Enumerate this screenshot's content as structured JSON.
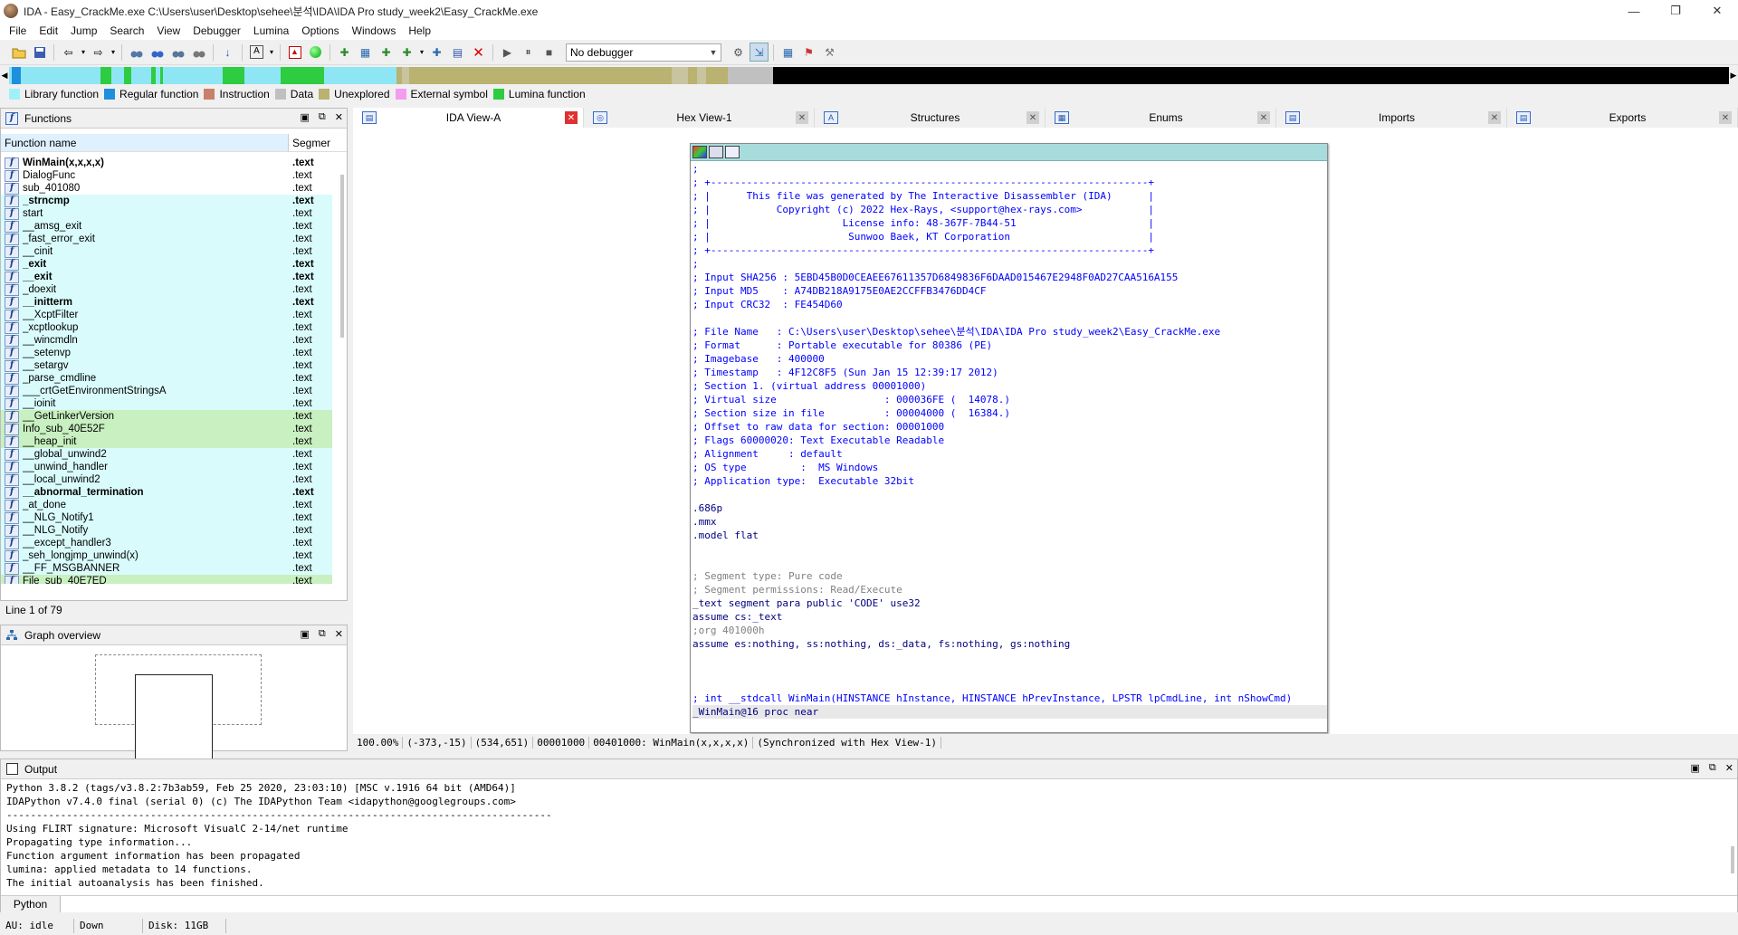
{
  "window": {
    "title": "IDA - Easy_CrackMe.exe C:\\Users\\user\\Desktop\\sehee\\분석\\IDA\\IDA Pro study_week2\\Easy_CrackMe.exe",
    "minimize": "—",
    "restore": "❐",
    "close": "✕"
  },
  "menu": [
    "File",
    "Edit",
    "Jump",
    "Search",
    "View",
    "Debugger",
    "Lumina",
    "Options",
    "Windows",
    "Help"
  ],
  "toolbar": {
    "debugger_select": "No debugger"
  },
  "navband": {
    "segments": [
      {
        "color": "#8ee6f4",
        "w": 3
      },
      {
        "color": "#1e8fdc",
        "w": 10
      },
      {
        "color": "#8ee6f4",
        "w": 88
      },
      {
        "color": "#2ecc40",
        "w": 12
      },
      {
        "color": "#8ee6f4",
        "w": 14
      },
      {
        "color": "#2ecc40",
        "w": 8
      },
      {
        "color": "#8ee6f4",
        "w": 22
      },
      {
        "color": "#2ecc40",
        "w": 5
      },
      {
        "color": "#8ee6f4",
        "w": 5
      },
      {
        "color": "#2ecc40",
        "w": 3
      },
      {
        "color": "#8ee6f4",
        "w": 66
      },
      {
        "color": "#2ecc40",
        "w": 24
      },
      {
        "color": "#8ee6f4",
        "w": 40
      },
      {
        "color": "#2ecc40",
        "w": 48
      },
      {
        "color": "#8ee6f4",
        "w": 80
      },
      {
        "color": "#b9b270",
        "w": 6
      },
      {
        "color": "#c8c4a0",
        "w": 8
      },
      {
        "color": "#b9b270",
        "w": 290
      },
      {
        "color": "#c8c4a0",
        "w": 18
      },
      {
        "color": "#b9b270",
        "w": 10
      },
      {
        "color": "#c8c4a0",
        "w": 10
      },
      {
        "color": "#b9b270",
        "w": 24
      },
      {
        "color": "#c0c0c0",
        "w": 50
      },
      {
        "color": "#000000",
        "w": 1056
      }
    ]
  },
  "legend": [
    {
      "label": "Library function",
      "color": "#a0f0f8"
    },
    {
      "label": "Regular function",
      "color": "#1e8fdc"
    },
    {
      "label": "Instruction",
      "color": "#c8806a"
    },
    {
      "label": "Data",
      "color": "#c0c0c0"
    },
    {
      "label": "Unexplored",
      "color": "#b9b270"
    },
    {
      "label": "External symbol",
      "color": "#f49cf0"
    },
    {
      "label": "Lumina function",
      "color": "#2ecc40"
    }
  ],
  "functions_panel": {
    "title": "Functions",
    "col_name": "Function name",
    "col_segment": "Segmer",
    "status": "Line 1 of 79",
    "rows": [
      {
        "name": "WinMain(x,x,x,x)",
        "seg": ".text",
        "bg": "plain",
        "bold": true
      },
      {
        "name": "DialogFunc",
        "seg": ".text",
        "bg": "plain",
        "bold": false
      },
      {
        "name": "sub_401080",
        "seg": ".text",
        "bg": "plain",
        "bold": false
      },
      {
        "name": "_strncmp",
        "seg": ".text",
        "bg": "lib",
        "bold": true
      },
      {
        "name": "start",
        "seg": ".text",
        "bg": "lib",
        "bold": false
      },
      {
        "name": "__amsg_exit",
        "seg": ".text",
        "bg": "lib",
        "bold": false
      },
      {
        "name": "_fast_error_exit",
        "seg": ".text",
        "bg": "lib",
        "bold": false
      },
      {
        "name": "__cinit",
        "seg": ".text",
        "bg": "lib",
        "bold": false
      },
      {
        "name": "_exit",
        "seg": ".text",
        "bg": "lib",
        "bold": true
      },
      {
        "name": "__exit",
        "seg": ".text",
        "bg": "lib",
        "bold": true
      },
      {
        "name": "_doexit",
        "seg": ".text",
        "bg": "lib",
        "bold": false
      },
      {
        "name": "__initterm",
        "seg": ".text",
        "bg": "lib",
        "bold": true
      },
      {
        "name": "__XcptFilter",
        "seg": ".text",
        "bg": "lib",
        "bold": false
      },
      {
        "name": "_xcptlookup",
        "seg": ".text",
        "bg": "lib",
        "bold": false
      },
      {
        "name": "__wincmdln",
        "seg": ".text",
        "bg": "lib",
        "bold": false
      },
      {
        "name": "__setenvp",
        "seg": ".text",
        "bg": "lib",
        "bold": false
      },
      {
        "name": "__setargv",
        "seg": ".text",
        "bg": "lib",
        "bold": false
      },
      {
        "name": "_parse_cmdline",
        "seg": ".text",
        "bg": "lib",
        "bold": false
      },
      {
        "name": "___crtGetEnvironmentStringsA",
        "seg": ".text",
        "bg": "lib",
        "bold": false
      },
      {
        "name": "__ioinit",
        "seg": ".text",
        "bg": "lib",
        "bold": false
      },
      {
        "name": "__GetLinkerVersion",
        "seg": ".text",
        "bg": "lum",
        "bold": false
      },
      {
        "name": "Info_sub_40E52F",
        "seg": ".text",
        "bg": "lum",
        "bold": false
      },
      {
        "name": "__heap_init",
        "seg": ".text",
        "bg": "lum",
        "bold": false
      },
      {
        "name": "__global_unwind2",
        "seg": ".text",
        "bg": "lib",
        "bold": false
      },
      {
        "name": "__unwind_handler",
        "seg": ".text",
        "bg": "lib",
        "bold": false
      },
      {
        "name": "__local_unwind2",
        "seg": ".text",
        "bg": "lib",
        "bold": false
      },
      {
        "name": "__abnormal_termination",
        "seg": ".text",
        "bg": "lib",
        "bold": true
      },
      {
        "name": "_at_done",
        "seg": ".text",
        "bg": "lib",
        "bold": false
      },
      {
        "name": "__NLG_Notify1",
        "seg": ".text",
        "bg": "lib",
        "bold": false
      },
      {
        "name": "__NLG_Notify",
        "seg": ".text",
        "bg": "lib",
        "bold": false
      },
      {
        "name": "__except_handler3",
        "seg": ".text",
        "bg": "lib",
        "bold": false
      },
      {
        "name": "_seh_longjmp_unwind(x)",
        "seg": ".text",
        "bg": "lib",
        "bold": false
      },
      {
        "name": "__FF_MSGBANNER",
        "seg": ".text",
        "bg": "lib",
        "bold": false
      },
      {
        "name": "File_sub_40E7ED",
        "seg": ".text",
        "bg": "lum",
        "bold": false
      }
    ]
  },
  "graph_panel": {
    "title": "Graph overview"
  },
  "tabs": [
    {
      "label": "IDA View-A",
      "active": true,
      "icon": "ida-view-icon"
    },
    {
      "label": "Hex View-1",
      "active": false,
      "icon": "hex-view-icon"
    },
    {
      "label": "Structures",
      "active": false,
      "icon": "structures-icon"
    },
    {
      "label": "Enums",
      "active": false,
      "icon": "enums-icon"
    },
    {
      "label": "Imports",
      "active": false,
      "icon": "imports-icon"
    },
    {
      "label": "Exports",
      "active": false,
      "icon": "exports-icon"
    }
  ],
  "disasm_lines": [
    {
      "t": ";",
      "c": "c-blue"
    },
    {
      "t": "; +-------------------------------------------------------------------------+",
      "c": "c-blue"
    },
    {
      "t": "; |      This file was generated by The Interactive Disassembler (IDA)      |",
      "c": "c-blue"
    },
    {
      "t": "; |           Copyright (c) 2022 Hex-Rays, <support@hex-rays.com>           |",
      "c": "c-blue"
    },
    {
      "t": "; |                      License info: 48-367F-7B44-51                      |",
      "c": "c-blue"
    },
    {
      "t": "; |                       Sunwoo Baek, KT Corporation                       |",
      "c": "c-blue"
    },
    {
      "t": "; +-------------------------------------------------------------------------+",
      "c": "c-blue"
    },
    {
      "t": ";",
      "c": "c-blue"
    },
    {
      "t": "; Input SHA256 : 5EBD45B0D0CEAEE67611357D6849836F6DAAD015467E2948F0AD27CAA516A155",
      "c": "c-blue"
    },
    {
      "t": "; Input MD5    : A74DB218A9175E0AE2CCFFB3476DD4CF",
      "c": "c-blue"
    },
    {
      "t": "; Input CRC32  : FE454D60",
      "c": "c-blue"
    },
    {
      "t": "",
      "c": ""
    },
    {
      "t": "; File Name   : C:\\Users\\user\\Desktop\\sehee\\분석\\IDA\\IDA Pro study_week2\\Easy_CrackMe.exe",
      "c": "c-blue"
    },
    {
      "t": "; Format      : Portable executable for 80386 (PE)",
      "c": "c-blue"
    },
    {
      "t": "; Imagebase   : 400000",
      "c": "c-blue"
    },
    {
      "t": "; Timestamp   : 4F12C8F5 (Sun Jan 15 12:39:17 2012)",
      "c": "c-blue"
    },
    {
      "t": "; Section 1. (virtual address 00001000)",
      "c": "c-blue"
    },
    {
      "t": "; Virtual size                  : 000036FE (  14078.)",
      "c": "c-blue"
    },
    {
      "t": "; Section size in file          : 00004000 (  16384.)",
      "c": "c-blue"
    },
    {
      "t": "; Offset to raw data for section: 00001000",
      "c": "c-blue"
    },
    {
      "t": "; Flags 60000020: Text Executable Readable",
      "c": "c-blue"
    },
    {
      "t": "; Alignment     : default",
      "c": "c-blue"
    },
    {
      "t": "; OS type         :  MS Windows",
      "c": "c-blue"
    },
    {
      "t": "; Application type:  Executable 32bit",
      "c": "c-blue"
    },
    {
      "t": "",
      "c": ""
    },
    {
      "t": ".686p",
      "c": "c-dark"
    },
    {
      "t": ".mmx",
      "c": "c-dark"
    },
    {
      "t": ".model flat",
      "c": "c-dark"
    },
    {
      "t": "",
      "c": ""
    },
    {
      "t": "",
      "c": ""
    },
    {
      "t": "; Segment type: Pure code",
      "c": "c-gray"
    },
    {
      "t": "; Segment permissions: Read/Execute",
      "c": "c-gray"
    },
    {
      "t": "_text segment para public 'CODE' use32",
      "c": "c-dark"
    },
    {
      "t": "assume cs:_text",
      "c": "c-dark"
    },
    {
      "t": ";org 401000h",
      "c": "c-gray"
    },
    {
      "t": "assume es:nothing, ss:nothing, ds:_data, fs:nothing, gs:nothing",
      "c": "c-dark"
    },
    {
      "t": "",
      "c": ""
    },
    {
      "t": "",
      "c": ""
    },
    {
      "t": "",
      "c": ""
    },
    {
      "t": "; int __stdcall WinMain(HINSTANCE hInstance, HINSTANCE hPrevInstance, LPSTR lpCmdLine, int nShowCmd)",
      "c": "c-blue"
    },
    {
      "t": "_WinMain@16 proc near",
      "c": "c-dark c-hl"
    }
  ],
  "ida_status": [
    "100.00%",
    "(-373,-15)",
    "(534,651)",
    "00001000",
    "00401000: WinMain(x,x,x,x)",
    "(Synchronized with Hex View-1)"
  ],
  "output_panel": {
    "title": "Output",
    "lines": [
      "Python 3.8.2 (tags/v3.8.2:7b3ab59, Feb 25 2020, 23:03:10) [MSC v.1916 64 bit (AMD64)]",
      "IDAPython v7.4.0 final (serial 0) (c) The IDAPython Team <idapython@googlegroups.com>",
      "-------------------------------------------------------------------------------------------",
      "Using FLIRT signature: Microsoft VisualC 2-14/net runtime",
      "Propagating type information...",
      "Function argument information has been propagated",
      "lumina: applied metadata to 14 functions.",
      "The initial autoanalysis has been finished."
    ],
    "lang_button": "Python"
  },
  "statusbar": {
    "au": "AU:  idle",
    "dir": "Down",
    "disk": "Disk: 11GB"
  }
}
